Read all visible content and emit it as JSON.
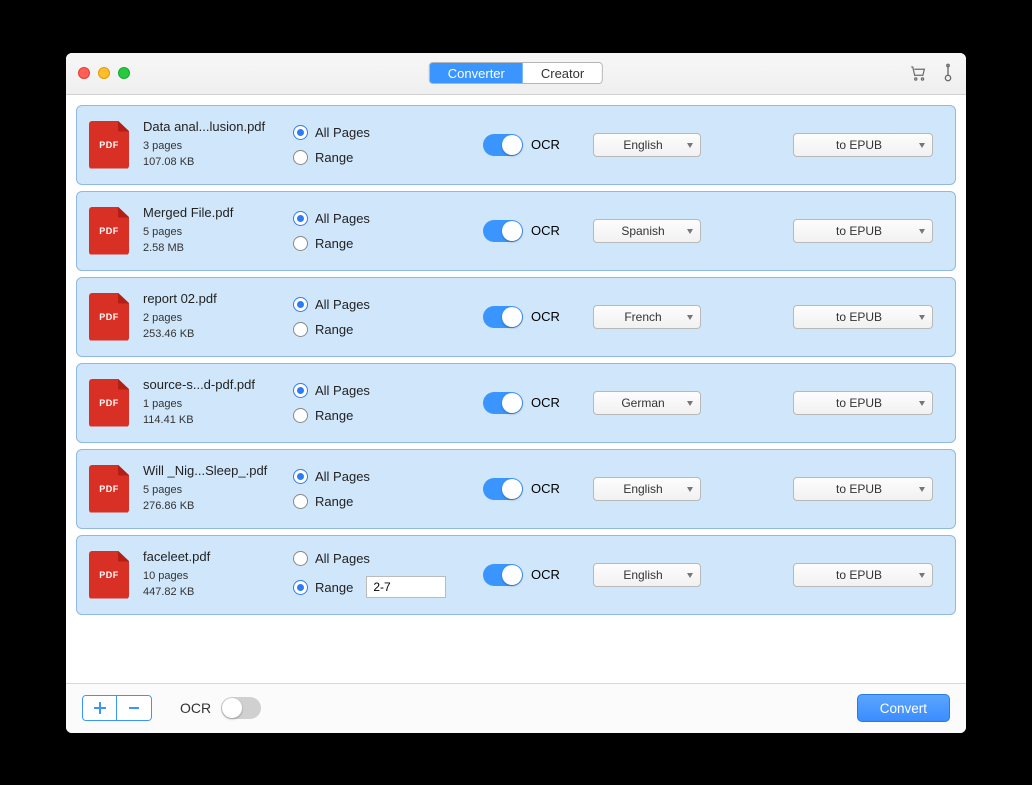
{
  "tabs": {
    "converter": "Converter",
    "creator": "Creator",
    "active": "converter"
  },
  "labels": {
    "allPages": "All Pages",
    "range": "Range",
    "ocr": "OCR",
    "pdfBadge": "PDF"
  },
  "footer": {
    "ocrLabel": "OCR",
    "convert": "Convert"
  },
  "files": [
    {
      "name": "Data anal...lusion.pdf",
      "pages": "3 pages",
      "size": "107.08 KB",
      "pageMode": "all",
      "rangeValue": "",
      "ocr": true,
      "lang": "English",
      "format": "to EPUB"
    },
    {
      "name": "Merged File.pdf",
      "pages": "5 pages",
      "size": "2.58 MB",
      "pageMode": "all",
      "rangeValue": "",
      "ocr": true,
      "lang": "Spanish",
      "format": "to EPUB"
    },
    {
      "name": "report 02.pdf",
      "pages": "2 pages",
      "size": "253.46 KB",
      "pageMode": "all",
      "rangeValue": "",
      "ocr": true,
      "lang": "French",
      "format": "to EPUB"
    },
    {
      "name": "source-s...d-pdf.pdf",
      "pages": "1 pages",
      "size": "114.41 KB",
      "pageMode": "all",
      "rangeValue": "",
      "ocr": true,
      "lang": "German",
      "format": "to EPUB"
    },
    {
      "name": "Will _Nig...Sleep_.pdf",
      "pages": "5 pages",
      "size": "276.86 KB",
      "pageMode": "all",
      "rangeValue": "",
      "ocr": true,
      "lang": "English",
      "format": "to EPUB"
    },
    {
      "name": "faceleet.pdf",
      "pages": "10 pages",
      "size": "447.82 KB",
      "pageMode": "range",
      "rangeValue": "2-7",
      "ocr": true,
      "lang": "English",
      "format": "to EPUB"
    }
  ],
  "footerOcr": false
}
